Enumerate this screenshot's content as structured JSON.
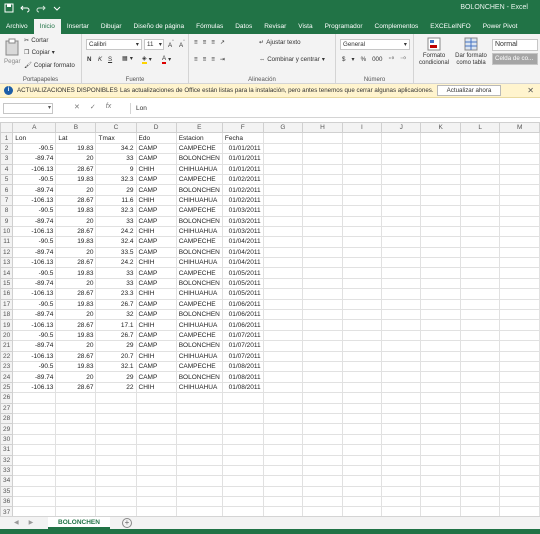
{
  "window": {
    "title": "BOLONCHEN - Excel"
  },
  "tabs": [
    "Archivo",
    "Inicio",
    "Insertar",
    "Dibujar",
    "Diseño de página",
    "Fórmulas",
    "Datos",
    "Revisar",
    "Vista",
    "Programador",
    "Complementos",
    "EXCELeINFO",
    "Power Pivot"
  ],
  "ribbon": {
    "clipboard": {
      "paste": "Pegar",
      "cut": "Cortar",
      "copy": "Copiar",
      "format_painter": "Copiar formato",
      "label": "Portapapeles"
    },
    "font": {
      "name": "Calibri",
      "size": "11",
      "bold": "N",
      "italic": "K",
      "underline": "S",
      "label": "Fuente"
    },
    "alignment": {
      "wrap": "Ajustar texto",
      "merge": "Combinar y centrar",
      "label": "Alineación"
    },
    "number": {
      "format": "General",
      "currency": "$",
      "percent": "%",
      "label": "Número"
    },
    "styles": {
      "conditional": "Formato condicional",
      "as_table": "Dar formato como tabla",
      "normal": "Normal",
      "check_cell": "Celda de co..."
    }
  },
  "notification": {
    "heading": "ACTUALIZACIONES DISPONIBLES",
    "message": "Las actualizaciones de Office están listas para la instalación, pero antes tenemos que cerrar algunas aplicaciones.",
    "button": "Actualizar ahora"
  },
  "formula_bar": {
    "name_box": "",
    "fx": "fx",
    "value": "Lon"
  },
  "sheet": {
    "columns": [
      "A",
      "B",
      "C",
      "D",
      "E",
      "F",
      "G",
      "H",
      "I",
      "J",
      "K",
      "L",
      "M"
    ],
    "header_row": [
      "Lon",
      "Lat",
      "Tmax",
      "Edo",
      "Estacion",
      "Fecha"
    ],
    "rows": [
      [
        "-90.5",
        "19.83",
        "34.2",
        "CAMP",
        "CAMPECHE",
        "01/01/2011"
      ],
      [
        "-89.74",
        "20",
        "33",
        "CAMP",
        "BOLONCHEN",
        "01/01/2011"
      ],
      [
        "-106.13",
        "28.67",
        "9",
        "CHIH",
        "CHIHUAHUA",
        "01/01/2011"
      ],
      [
        "-90.5",
        "19.83",
        "32.3",
        "CAMP",
        "CAMPECHE",
        "01/02/2011"
      ],
      [
        "-89.74",
        "20",
        "29",
        "CAMP",
        "BOLONCHEN",
        "01/02/2011"
      ],
      [
        "-106.13",
        "28.67",
        "11.6",
        "CHIH",
        "CHIHUAHUA",
        "01/02/2011"
      ],
      [
        "-90.5",
        "19.83",
        "32.3",
        "CAMP",
        "CAMPECHE",
        "01/03/2011"
      ],
      [
        "-89.74",
        "20",
        "33",
        "CAMP",
        "BOLONCHEN",
        "01/03/2011"
      ],
      [
        "-106.13",
        "28.67",
        "24.2",
        "CHIH",
        "CHIHUAHUA",
        "01/03/2011"
      ],
      [
        "-90.5",
        "19.83",
        "32.4",
        "CAMP",
        "CAMPECHE",
        "01/04/2011"
      ],
      [
        "-89.74",
        "20",
        "33.5",
        "CAMP",
        "BOLONCHEN",
        "01/04/2011"
      ],
      [
        "-106.13",
        "28.67",
        "24.2",
        "CHIH",
        "CHIHUAHUA",
        "01/04/2011"
      ],
      [
        "-90.5",
        "19.83",
        "33",
        "CAMP",
        "CAMPECHE",
        "01/05/2011"
      ],
      [
        "-89.74",
        "20",
        "33",
        "CAMP",
        "BOLONCHEN",
        "01/05/2011"
      ],
      [
        "-106.13",
        "28.67",
        "23.3",
        "CHIH",
        "CHIHUAHUA",
        "01/05/2011"
      ],
      [
        "-90.5",
        "19.83",
        "26.7",
        "CAMP",
        "CAMPECHE",
        "01/06/2011"
      ],
      [
        "-89.74",
        "20",
        "32",
        "CAMP",
        "BOLONCHEN",
        "01/06/2011"
      ],
      [
        "-106.13",
        "28.67",
        "17.1",
        "CHIH",
        "CHIHUAHUA",
        "01/06/2011"
      ],
      [
        "-90.5",
        "19.83",
        "26.7",
        "CAMP",
        "CAMPECHE",
        "01/07/2011"
      ],
      [
        "-89.74",
        "20",
        "29",
        "CAMP",
        "BOLONCHEN",
        "01/07/2011"
      ],
      [
        "-106.13",
        "28.67",
        "20.7",
        "CHIH",
        "CHIHUAHUA",
        "01/07/2011"
      ],
      [
        "-90.5",
        "19.83",
        "32.1",
        "CAMP",
        "CAMPECHE",
        "01/08/2011"
      ],
      [
        "-89.74",
        "20",
        "29",
        "CAMP",
        "BOLONCHEN",
        "01/08/2011"
      ],
      [
        "-106.13",
        "28.67",
        "22",
        "CHIH",
        "CHIHUAHUA",
        "01/08/2011"
      ]
    ],
    "empty_row_numbers": [
      "26",
      "27",
      "28",
      "29",
      "30",
      "31",
      "32",
      "33",
      "34",
      "35",
      "36",
      "37"
    ]
  },
  "sheet_tabs": {
    "active": "BOLONCHEN"
  },
  "colors": {
    "accent": "#217346",
    "notify_bg": "#fff4ce"
  }
}
